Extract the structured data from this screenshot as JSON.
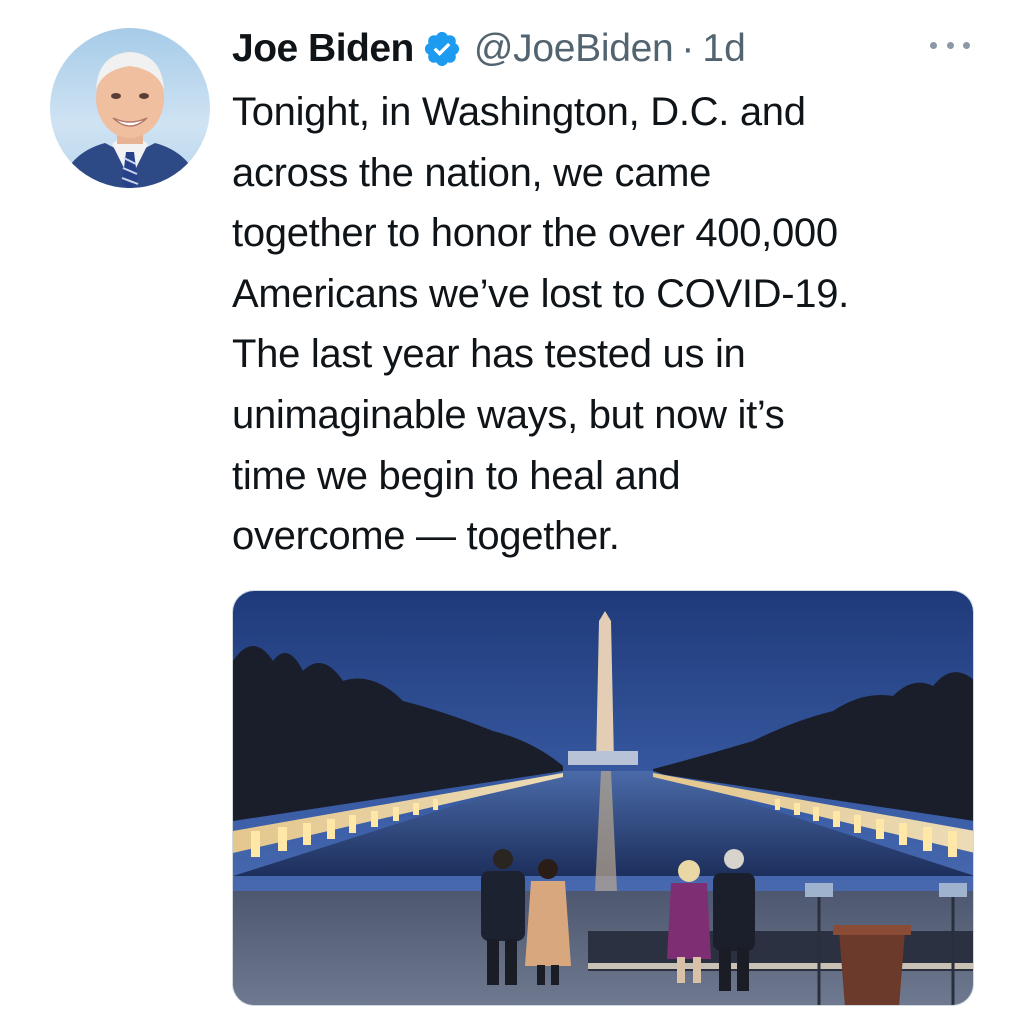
{
  "tweet": {
    "author_name": "Joe Biden",
    "handle": "@JoeBiden",
    "separator": "·",
    "time": "1d",
    "verified": true,
    "text_lines": [
      "Tonight, in Washington, D.C. and",
      "across the nation, we came",
      "together to honor the over 400,000",
      "Americans we’ve lost to COVID-19.",
      "The last year has tested us in",
      "unimaginable ways, but now it’s",
      "time we begin to heal and",
      "overcome — together."
    ]
  },
  "icons": {
    "verified": "verified-badge-icon",
    "more": "more-options-icon"
  },
  "colors": {
    "verified_blue": "#1d9bf0",
    "secondary_text": "#536471",
    "primary_text": "#0f1419"
  }
}
